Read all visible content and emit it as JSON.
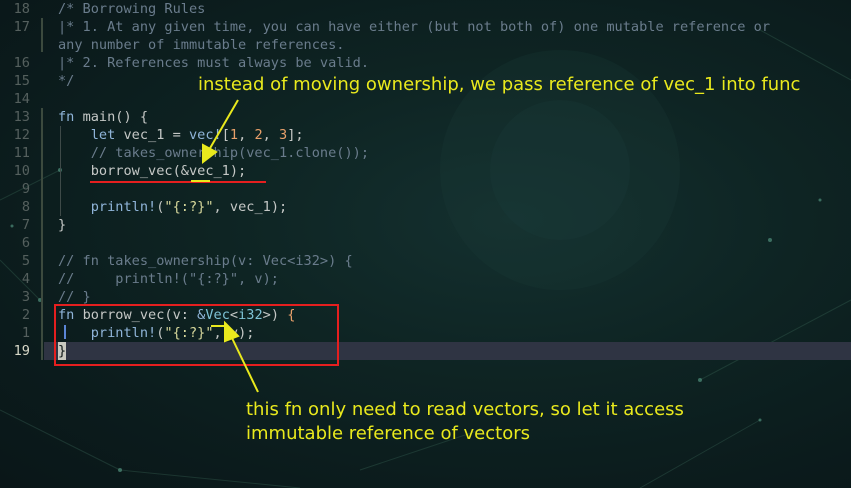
{
  "editor": {
    "lines": [
      {
        "num": "18",
        "tokens": [
          {
            "c": "cm",
            "t": "/* Borrowing Rules"
          }
        ]
      },
      {
        "num": "17",
        "tokens": [
          {
            "c": "cm",
            "t": "|* 1. At any given time, you can have either (but not both of) one mutable reference or"
          }
        ]
      },
      {
        "num": "",
        "tokens": [
          {
            "c": "cm",
            "t": "any number of immutable references."
          }
        ]
      },
      {
        "num": "16",
        "tokens": [
          {
            "c": "cm",
            "t": "|* 2. References must always be valid."
          }
        ]
      },
      {
        "num": "15",
        "tokens": [
          {
            "c": "cm",
            "t": "*/"
          }
        ]
      },
      {
        "num": "14",
        "tokens": []
      },
      {
        "num": "13",
        "tokens": [
          {
            "c": "kw",
            "t": "fn "
          },
          {
            "c": "tx",
            "t": "main() {"
          }
        ]
      },
      {
        "num": "12",
        "tokens": [
          {
            "c": "tx",
            "t": "    "
          },
          {
            "c": "kw",
            "t": "let "
          },
          {
            "c": "tx",
            "t": "vec_1 = "
          },
          {
            "c": "mc",
            "t": "vec!"
          },
          {
            "c": "tx",
            "t": "["
          },
          {
            "c": "nm",
            "t": "1"
          },
          {
            "c": "tx",
            "t": ", "
          },
          {
            "c": "nm",
            "t": "2"
          },
          {
            "c": "tx",
            "t": ", "
          },
          {
            "c": "nm",
            "t": "3"
          },
          {
            "c": "tx",
            "t": "];"
          }
        ]
      },
      {
        "num": "11",
        "tokens": [
          {
            "c": "tx",
            "t": "    "
          },
          {
            "c": "cm",
            "t": "// takes_ownership(vec_1.clone());"
          }
        ]
      },
      {
        "num": "10",
        "tokens": [
          {
            "c": "tx",
            "t": "    borrow_vec(&vec_1);"
          }
        ]
      },
      {
        "num": "9",
        "tokens": []
      },
      {
        "num": "8",
        "tokens": [
          {
            "c": "tx",
            "t": "    "
          },
          {
            "c": "mc",
            "t": "println!"
          },
          {
            "c": "tx",
            "t": "("
          },
          {
            "c": "st",
            "t": "\"{:?}\""
          },
          {
            "c": "tx",
            "t": ", vec_1);"
          }
        ]
      },
      {
        "num": "7",
        "tokens": [
          {
            "c": "tx",
            "t": "}"
          }
        ]
      },
      {
        "num": "6",
        "tokens": []
      },
      {
        "num": "5",
        "tokens": [
          {
            "c": "cm",
            "t": "// fn takes_ownership(v: Vec<i32>) {"
          }
        ]
      },
      {
        "num": "4",
        "tokens": [
          {
            "c": "cm",
            "t": "//     println!(\"{:?}\", v);"
          }
        ]
      },
      {
        "num": "3",
        "tokens": [
          {
            "c": "cm",
            "t": "// }"
          }
        ]
      },
      {
        "num": "2",
        "tokens": [
          {
            "c": "kw",
            "t": "fn "
          },
          {
            "c": "tx",
            "t": "borrow_vec(v: "
          },
          {
            "c": "kw",
            "t": "&"
          },
          {
            "c": "ty",
            "t": "Vec"
          },
          {
            "c": "tx",
            "t": "<"
          },
          {
            "c": "ty",
            "t": "i32"
          },
          {
            "c": "tx",
            "t": ">) "
          },
          {
            "c": "ob",
            "t": "{"
          }
        ]
      },
      {
        "num": "1",
        "tokens": [
          {
            "c": "tx",
            "t": "    "
          },
          {
            "c": "mc",
            "t": "println!"
          },
          {
            "c": "tx",
            "t": "("
          },
          {
            "c": "st",
            "t": "\"{:?}\""
          },
          {
            "c": "tx",
            "t": ", v);"
          }
        ]
      },
      {
        "num": "19",
        "current": true,
        "tokens": [
          {
            "c": "cursor",
            "t": "}"
          }
        ]
      }
    ]
  },
  "annotations": {
    "top": "instead of moving ownership, we pass reference of vec_1 into func",
    "bottom_line1": "this fn only need to read vectors, so let it access",
    "bottom_line2": "immutable reference of vectors"
  },
  "colors": {
    "annotation": "#e9e91d",
    "highlight_box": "#e51f1f",
    "background": "#0e2423",
    "current_line": "#2f3443"
  }
}
